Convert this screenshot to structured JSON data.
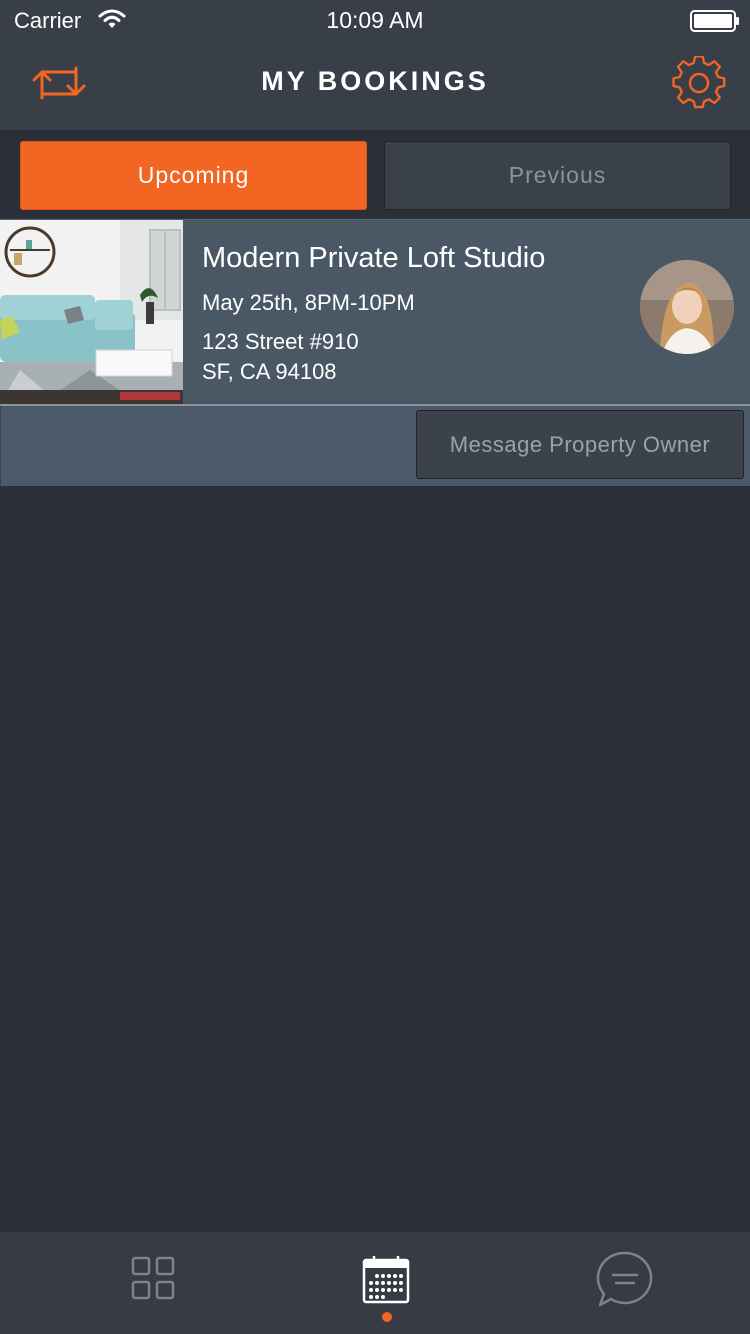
{
  "status_bar": {
    "carrier": "Carrier",
    "time": "10:09 AM"
  },
  "nav": {
    "title": "MY BOOKINGS",
    "left_icon": "swap-arrows-icon",
    "right_icon": "gear-icon"
  },
  "tabs": {
    "upcoming": "Upcoming",
    "previous": "Previous",
    "selected": "upcoming"
  },
  "booking": {
    "title": "Modern Private Loft Studio",
    "date": "May 25th, 8PM-10PM",
    "address_line1": "123 Street #910",
    "address_line2": "SF, CA 94108",
    "message_button": "Message Property Owner"
  },
  "tab_bar": {
    "items": [
      "grid-icon",
      "calendar-icon",
      "chat-icon"
    ],
    "active": "calendar-icon"
  },
  "colors": {
    "accent": "#f26522",
    "header_bg": "#393f48",
    "page_bg": "#2b2f37",
    "card_bg": "#4a5866"
  }
}
